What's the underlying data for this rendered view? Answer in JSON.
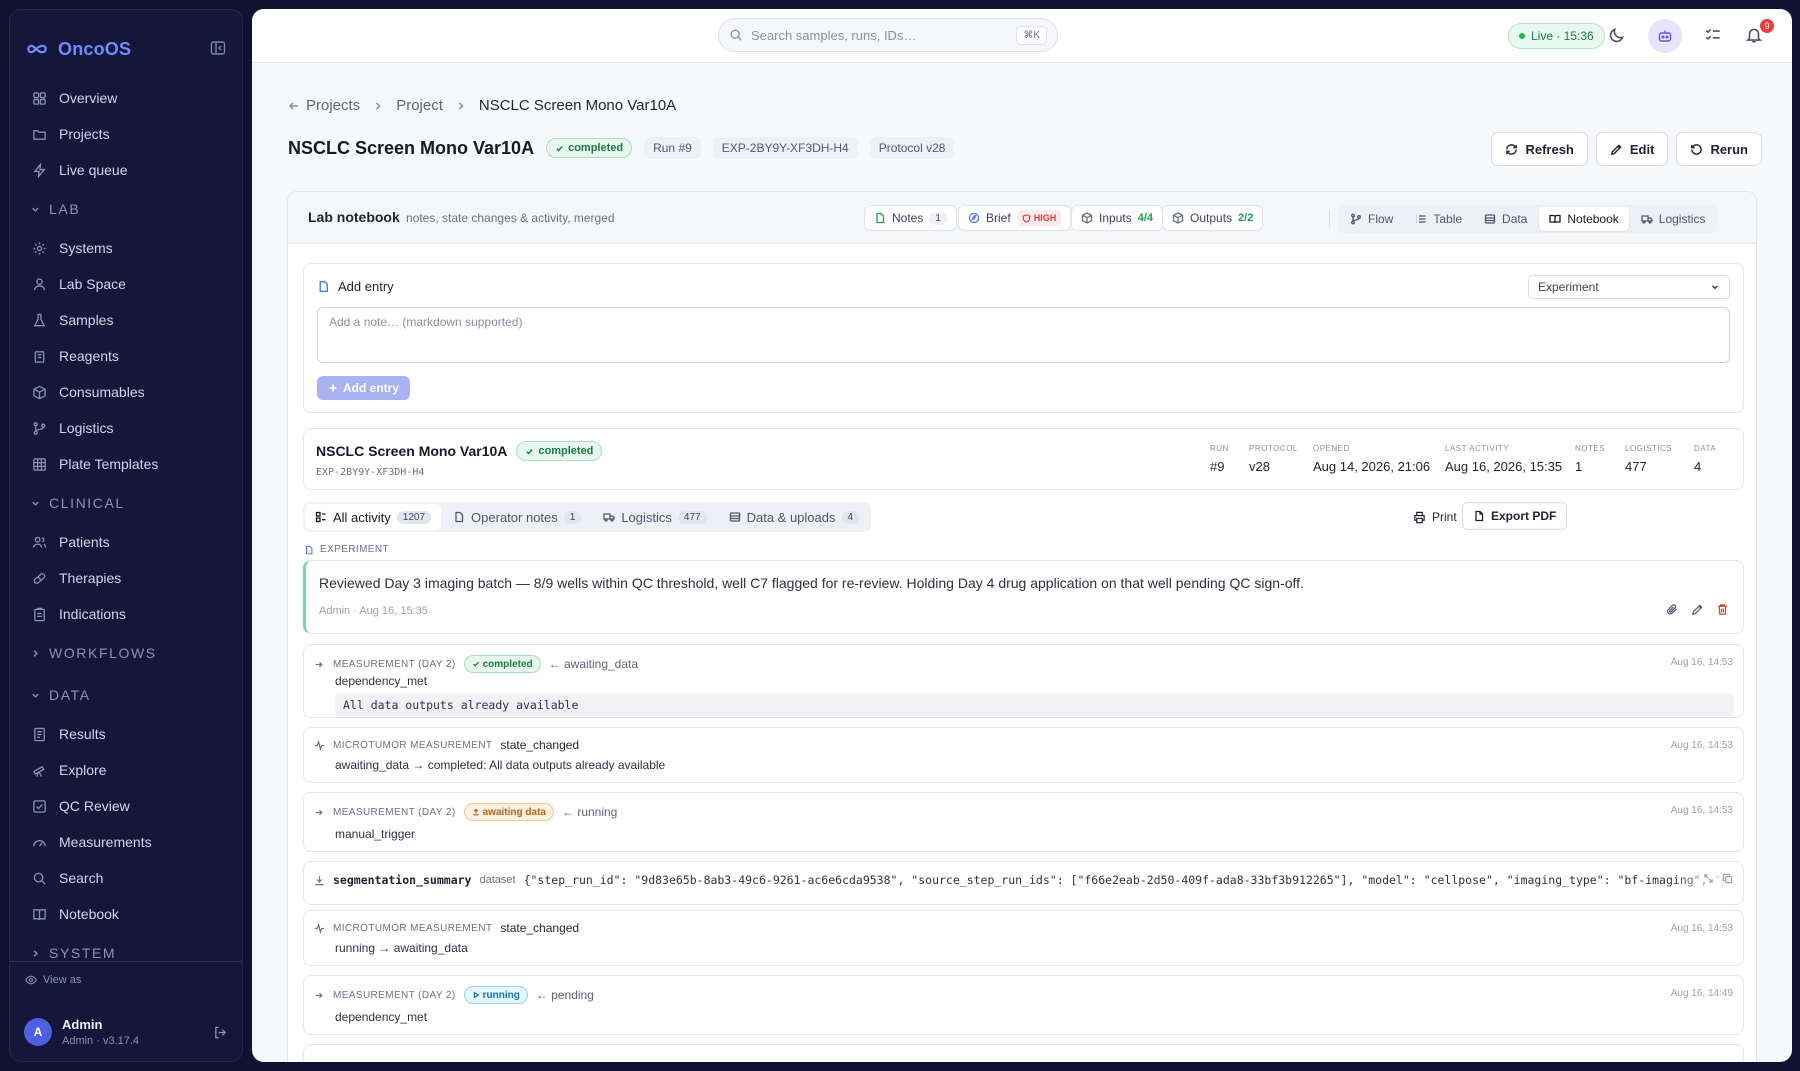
{
  "app": {
    "name": "OncoOS"
  },
  "sidebar": {
    "items_top": [
      {
        "label": "Overview",
        "icon": "grid-icon"
      },
      {
        "label": "Projects",
        "icon": "folder-icon"
      },
      {
        "label": "Live queue",
        "icon": "bolt-icon"
      }
    ],
    "lab": {
      "label": "LAB",
      "items": [
        {
          "label": "Systems"
        },
        {
          "label": "Lab Space"
        },
        {
          "label": "Samples"
        },
        {
          "label": "Reagents"
        },
        {
          "label": "Consumables"
        },
        {
          "label": "Logistics"
        },
        {
          "label": "Plate Templates"
        }
      ]
    },
    "clinical": {
      "label": "CLINICAL",
      "items": [
        {
          "label": "Patients"
        },
        {
          "label": "Therapies"
        },
        {
          "label": "Indications"
        }
      ]
    },
    "workflows": {
      "label": "WORKFLOWS"
    },
    "data": {
      "label": "DATA",
      "items": [
        {
          "label": "Results"
        },
        {
          "label": "Explore"
        },
        {
          "label": "QC Review"
        },
        {
          "label": "Measurements"
        },
        {
          "label": "Search"
        },
        {
          "label": "Notebook"
        }
      ]
    },
    "system": {
      "label": "SYSTEM"
    },
    "view_as": "View as",
    "user": {
      "name": "Admin",
      "initial": "A",
      "sub": "Admin · v3.17.4"
    }
  },
  "topbar": {
    "search_placeholder": "Search samples, runs, IDs…",
    "shortcut": "⌘K",
    "live": "Live · 15:36",
    "notifications": "9"
  },
  "breadcrumb": {
    "root": "Projects",
    "parent": "Project",
    "current": "NSCLC Screen Mono Var10A"
  },
  "header": {
    "title": "NSCLC Screen Mono Var10A",
    "status": "completed",
    "run": "Run #9",
    "exp_id": "EXP-2BY9Y-XF3DH-H4",
    "protocol": "Protocol v28",
    "actions": {
      "refresh": "Refresh",
      "edit": "Edit",
      "rerun": "Rerun"
    }
  },
  "notebook": {
    "title": "Lab notebook",
    "subtitle": "notes, state changes & activity, merged",
    "pills": {
      "notes": {
        "label": "Notes",
        "count": "1"
      },
      "brief": {
        "label": "Brief",
        "badge": "HIGH"
      },
      "inputs": {
        "label": "Inputs",
        "count": "4/4"
      },
      "outputs": {
        "label": "Outputs",
        "count": "2/2"
      }
    },
    "views": [
      "Flow",
      "Table",
      "Data",
      "Notebook",
      "Logistics"
    ],
    "active_view": "Notebook"
  },
  "add_entry": {
    "title": "Add entry",
    "type": "Experiment",
    "placeholder": "Add a note… (markdown supported)",
    "button": "Add entry"
  },
  "summary": {
    "name": "NSCLC Screen Mono Var10A",
    "status": "completed",
    "id": "EXP-2BY9Y-XF3DH-H4",
    "stats": [
      {
        "label": "RUN",
        "value": "#9"
      },
      {
        "label": "PROTOCOL",
        "value": "v28"
      },
      {
        "label": "OPENED",
        "value": "Aug 14, 2026, 21:06"
      },
      {
        "label": "LAST ACTIVITY",
        "value": "Aug 16, 2026, 15:35"
      },
      {
        "label": "NOTES",
        "value": "1"
      },
      {
        "label": "LOGISTICS",
        "value": "477"
      },
      {
        "label": "DATA",
        "value": "4"
      }
    ]
  },
  "filters": {
    "all": {
      "label": "All activity",
      "count": "1207"
    },
    "notes": {
      "label": "Operator notes",
      "count": "1"
    },
    "logistics": {
      "label": "Logistics",
      "count": "477"
    },
    "data": {
      "label": "Data & uploads",
      "count": "4"
    },
    "print": "Print",
    "export": "Export PDF"
  },
  "experiment_note": {
    "label": "EXPERIMENT",
    "text": "Reviewed Day 3 imaging batch — 8/9 wells within QC threshold, well C7 flagged for re-review. Holding Day 4 drug application on that well pending QC sign-off.",
    "meta": "Admin · Aug 16, 15:35"
  },
  "events": [
    {
      "kind": "MEASUREMENT (DAY 2)",
      "chip": "completed",
      "prev": "← awaiting_data",
      "line1": "dependency_met",
      "code": "All data outputs already available",
      "time": "Aug 16, 14:53"
    },
    {
      "kind": "MICROTUMOR MEASUREMENT",
      "name": "state_changed",
      "line1": "awaiting_data → completed: All data outputs already available",
      "time": "Aug 16, 14:53"
    },
    {
      "kind": "MEASUREMENT (DAY 2)",
      "chip": "awaiting data",
      "prev": "← running",
      "line1": "manual_trigger",
      "time": "Aug 16, 14:53"
    },
    {
      "name": "segmentation_summary",
      "kind": "dataset",
      "json": "{\"step_run_id\": \"9d83e65b-8ab3-49c6-9261-ac6e6cda9538\", \"source_step_run_ids\": [\"f66e2eab-2d50-409f-ada8-33bf3b912265\"], \"model\": \"cellpose\", \"imaging_type\": \"bf-imaging\", \"px"
    },
    {
      "kind": "MICROTUMOR MEASUREMENT",
      "name": "state_changed",
      "line1": "running → awaiting_data",
      "time": "Aug 16, 14:53"
    },
    {
      "kind": "MEASUREMENT (DAY 2)",
      "chip": "running",
      "prev": "← pending",
      "line1": "dependency_met",
      "time": "Aug 16, 14:49"
    }
  ]
}
